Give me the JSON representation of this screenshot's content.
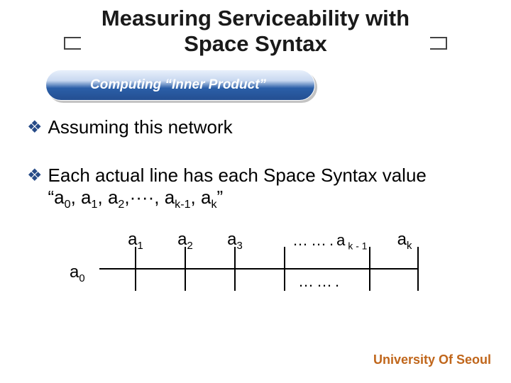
{
  "title": "Measuring Serviceability with\nSpace Syntax",
  "title_line1": "Measuring Serviceability with",
  "title_line2": "Space Syntax",
  "subtitle": "Computing “Inner Product”",
  "bullets": {
    "b1": "Assuming this network",
    "b2_line1": "Each actual line has each Space Syntax value",
    "b2_line2_prefix": "“a",
    "b2_line2_mid": ", a",
    "b2_line2_dots": ",····, a",
    "b2_line2_end": "”"
  },
  "subs": {
    "s0": "0",
    "s1": "1",
    "s2": "2",
    "skm1": "k-1",
    "sk": "k"
  },
  "diagram": {
    "a0": "a0",
    "a0_base": "a",
    "a0_sub": "0",
    "labels": [
      {
        "base": "a",
        "sub": "1"
      },
      {
        "base": "a",
        "sub": "2"
      },
      {
        "base": "a",
        "sub": "3"
      },
      {
        "base": "a",
        "sub": "k-1"
      },
      {
        "base": "a",
        "sub": "k"
      }
    ],
    "dots": "……."
  },
  "footer": "University Of Seoul"
}
